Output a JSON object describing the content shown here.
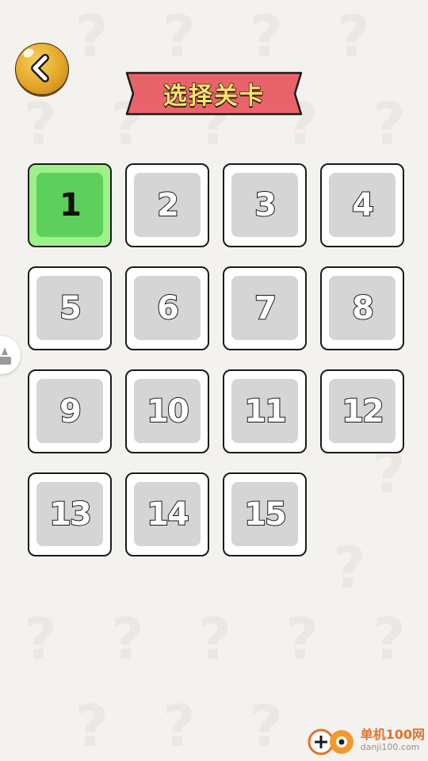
{
  "header": {
    "back_icon": "chevron-left-icon",
    "title": "选择关卡"
  },
  "levels": [
    {
      "label": "1",
      "state": "current"
    },
    {
      "label": "2",
      "state": "locked"
    },
    {
      "label": "3",
      "state": "locked"
    },
    {
      "label": "4",
      "state": "locked"
    },
    {
      "label": "5",
      "state": "locked"
    },
    {
      "label": "6",
      "state": "locked"
    },
    {
      "label": "7",
      "state": "locked"
    },
    {
      "label": "8",
      "state": "locked"
    },
    {
      "label": "9",
      "state": "locked"
    },
    {
      "label": "10",
      "state": "locked"
    },
    {
      "label": "11",
      "state": "locked"
    },
    {
      "label": "12",
      "state": "locked"
    },
    {
      "label": "13",
      "state": "locked"
    },
    {
      "label": "14",
      "state": "locked"
    },
    {
      "label": "15",
      "state": "locked"
    }
  ],
  "side_tab": {
    "icon": "sparkle-icon"
  },
  "background": {
    "mark": "?"
  },
  "watermark": {
    "name": "单机100网",
    "url": "danji100.com"
  },
  "colors": {
    "background": "#f4f2ee",
    "banner": "#e9646a",
    "title_text": "#ffe46a",
    "current_level": "#5ccf5c",
    "locked_level": "#d5d5d5",
    "back_button": "#e2a62a"
  }
}
